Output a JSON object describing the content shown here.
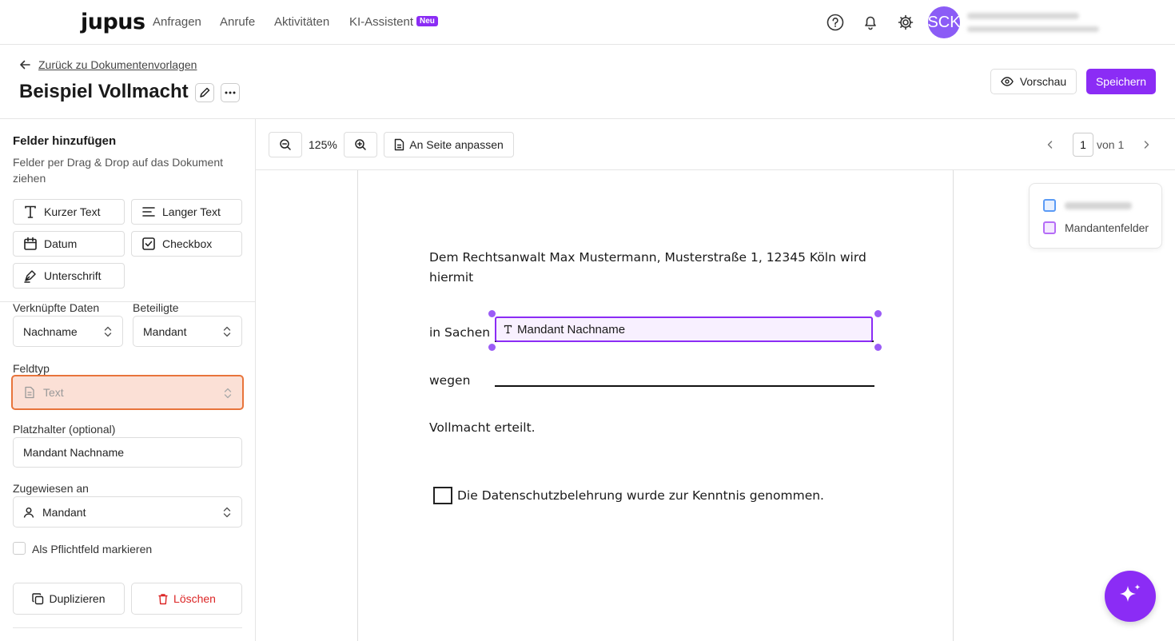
{
  "app": {
    "logo": "jupus",
    "nav": [
      "Anfragen",
      "Anrufe",
      "Aktivitäten",
      "KI-Assistent"
    ],
    "nav_badge": "Neu",
    "avatar_initials": "SCK",
    "brand_color": "#8b2cf5"
  },
  "header": {
    "back_label": "Zurück zu Dokumentenvorlagen",
    "title": "Beispiel Vollmacht",
    "preview_label": "Vorschau",
    "save_label": "Speichern"
  },
  "sidebar": {
    "title": "Felder hinzufügen",
    "subtitle": "Felder per Drag & Drop auf das Dokument ziehen",
    "field_types": [
      {
        "label": "Kurzer Text",
        "icon": "text-t-icon"
      },
      {
        "label": "Langer Text",
        "icon": "align-left-icon"
      },
      {
        "label": "Datum",
        "icon": "calendar-icon"
      },
      {
        "label": "Checkbox",
        "icon": "checkbox-icon"
      },
      {
        "label": "Unterschrift",
        "icon": "pen-icon"
      }
    ],
    "linked_data_label": "Verknüpfte Daten",
    "linked_data_value": "Nachname",
    "participants_label": "Beteiligte",
    "participants_value": "Mandant",
    "fieldtype_label": "Feldtyp",
    "fieldtype_value": "Text",
    "placeholder_label": "Platzhalter (optional)",
    "placeholder_value": "Mandant Nachname",
    "assigned_label": "Zugewiesen an",
    "assigned_value": "Mandant",
    "required_label": "Als Pflichtfeld markieren",
    "duplicate_label": "Duplizieren",
    "delete_label": "Löschen"
  },
  "toolbar": {
    "zoom": "125%",
    "fit_label": "An Seite anpassen",
    "page_current": "1",
    "page_of": "von 1"
  },
  "document": {
    "line1": "Dem Rechtsanwalt Max Mustermann, Musterstraße 1, 12345 Köln wird",
    "line2": "hiermit",
    "in_sachen": "in Sachen",
    "field_text": "Mandant Nachname",
    "wegen": "wegen",
    "vollmacht": "Vollmacht erteilt.",
    "checkbox_text": "Die Datenschutzbelehrung wurde zur Kenntnis genommen."
  },
  "legend": {
    "item2": "Mandantenfelder"
  }
}
